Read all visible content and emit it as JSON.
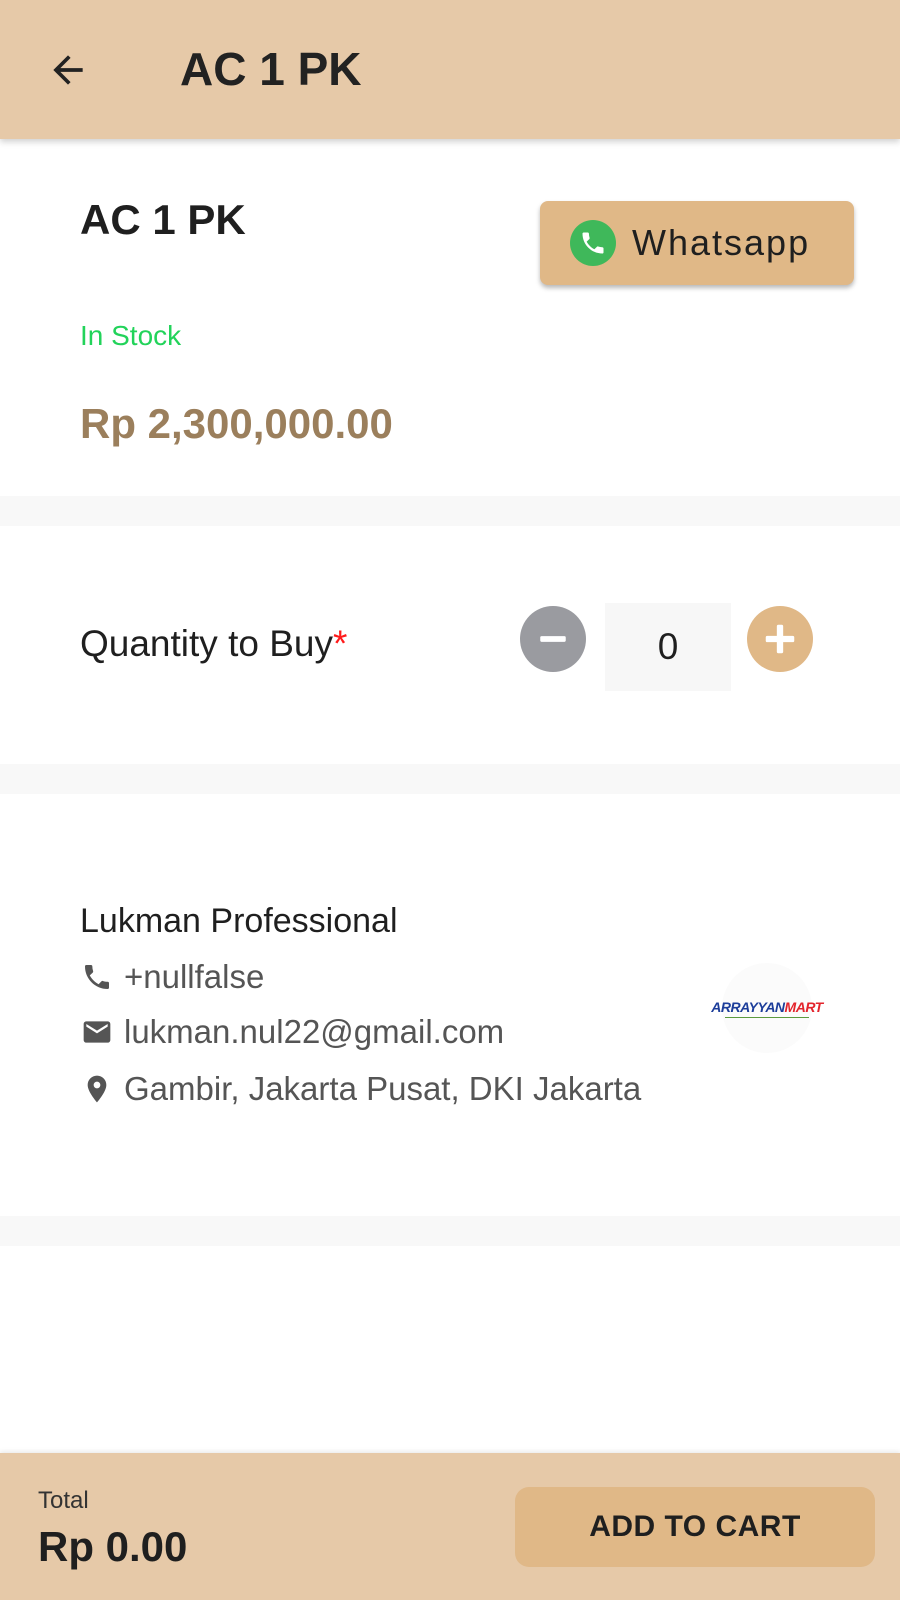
{
  "app_bar": {
    "title": "AC 1 PK",
    "back_icon": "arrow-back-icon"
  },
  "product": {
    "name": "AC 1 PK",
    "stock_status": "In Stock",
    "price": "Rp 2,300,000.00",
    "whatsapp_label": "Whatsapp",
    "whatsapp_icon": "whatsapp-icon"
  },
  "quantity": {
    "label": "Quantity to Buy",
    "required_mark": "*",
    "value": "0",
    "decrement_icon": "minus-icon",
    "increment_icon": "plus-icon"
  },
  "seller": {
    "name": "Lukman Professional",
    "phone": "+nullfalse",
    "email": "lukman.nul22@gmail.com",
    "address": "Gambir, Jakarta Pusat, DKI Jakarta",
    "logo_text_a": "ARRAYYAN",
    "logo_text_b": "MART"
  },
  "footer": {
    "total_label": "Total",
    "total_value": "Rp 0.00",
    "add_to_cart_label": "ADD TO CART"
  },
  "colors": {
    "header_bg": "#e6c9a8",
    "button_bg": "#e0b887",
    "price": "#9b7f5c",
    "in_stock": "#22d35a",
    "required": "#ff1a1a",
    "minus_bg": "#9a9ba0",
    "whatsapp_green": "#3fb85a"
  }
}
